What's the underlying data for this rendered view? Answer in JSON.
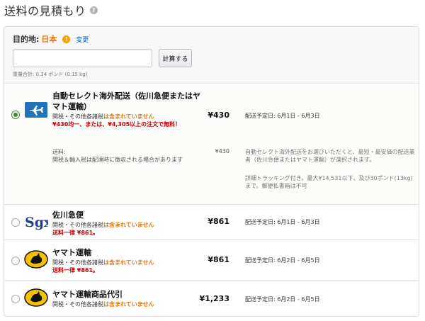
{
  "page": {
    "title": "送料の見積もり",
    "help_icon": "?"
  },
  "destination": {
    "label": "目的地:",
    "country": "日本",
    "info_icon": "!",
    "change_link": "変更",
    "input_placeholder": "",
    "calc_button": "計算する",
    "weight": "重量合計: 0.34 ポンド (0.15 kg)"
  },
  "options": [
    {
      "name": "自動セレクト海外配送（佐川急便またはヤマト運輸）",
      "logo": "airplane-icon",
      "note_prefix": "関税・その他各諸税",
      "note_warn": "は含まれていません",
      "free": "¥430均一、または、¥4,305以上の注文で無料！",
      "price": "¥430",
      "eta": "配送予定日: 6月1日 - 6月3日",
      "selected": true,
      "detail": {
        "label": "送料:",
        "note": "関税＆輸入税は配達時に徴収される場合があります",
        "price": "¥430",
        "desc1": "自動セレクト海外配送をお選びいただくと、最短・最安価の配送業者（佐川急便またはヤマト運輸）が選択されます。",
        "desc2": "詳細トラッキング付き。最大¥14,531以下、及び30ポンド(13kg)まで。郵便私書箱は不可"
      }
    },
    {
      "name": "佐川急便",
      "logo": "sagawa-logo",
      "logo_text": "Sgx",
      "note_prefix": "関税・その他各諸税",
      "note_warn": "は含まれていません",
      "free": "送料一律 ¥861。",
      "price": "¥861",
      "eta": "配送予定日: 6月1日 - 6月3日",
      "selected": false
    },
    {
      "name": "ヤマト運輸",
      "logo": "yamato-cat-logo",
      "note_prefix": "関税・その他各諸税",
      "note_warn": "は含まれていません",
      "free": "送料一律 ¥861。",
      "price": "¥861",
      "eta": "配送予定日: 6月2日 - 6月5日",
      "selected": false
    },
    {
      "name": "ヤマト運輸商品代引",
      "logo": "yamato-cat-logo",
      "note_prefix": "関税・その他各諸税",
      "note_warn": "は含まれていません",
      "price": "¥1,233",
      "eta": "配送予定日: 6月2日 - 6月5日",
      "selected": false
    }
  ],
  "colors": {
    "accent": "#e47911",
    "selected_radio": "#3f8a2f",
    "free_text": "#c40000",
    "link": "#0066c0"
  }
}
